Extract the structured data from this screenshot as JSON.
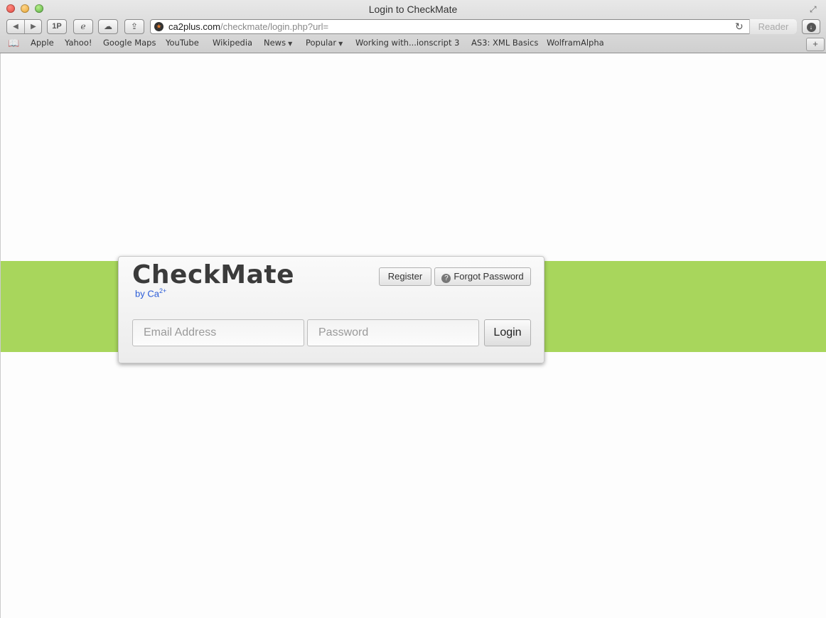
{
  "window": {
    "title": "Login to CheckMate"
  },
  "toolbar": {
    "url_host": "ca2plus.com",
    "url_path": "/checkmate/login.php?url=",
    "reader_label": "Reader",
    "onepassword_label": "1P"
  },
  "bookmarks": [
    {
      "label": "Apple"
    },
    {
      "label": "Yahoo!"
    },
    {
      "label": "Google Maps"
    },
    {
      "label": "YouTube"
    },
    {
      "label": "Wikipedia"
    },
    {
      "label": "News"
    },
    {
      "label": "Popular"
    },
    {
      "label": "Working with...ionscript 3"
    },
    {
      "label": "AS3: XML Basics"
    },
    {
      "label": "WolframAlpha"
    }
  ],
  "login": {
    "logo": "CheckMate",
    "byline_prefix": "by Ca",
    "byline_sup": "2+",
    "register_label": "Register",
    "forgot_label": "Forgot Password",
    "email_placeholder": "Email Address",
    "password_placeholder": "Password",
    "login_label": "Login"
  },
  "colors": {
    "band": "#a8d65c",
    "byline": "#2a5bd7"
  }
}
